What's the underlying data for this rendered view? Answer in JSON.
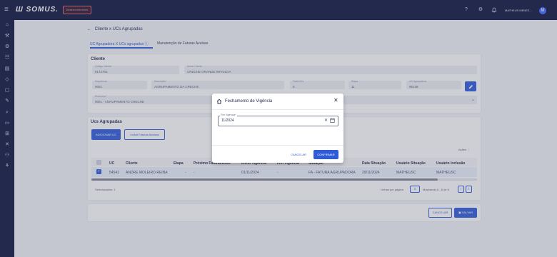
{
  "topbar": {
    "menu_icon": "≡",
    "logo": "Ш SOMUS.",
    "env_badge": "Desenvolvimento",
    "help_icon": "?",
    "settings_icon": "⚙",
    "bell_icon": "🔔",
    "user_name": "MATHEUS MENEZ...",
    "avatar": "M"
  },
  "sidebar": {
    "icons": [
      "⌂",
      "⚒",
      "⚙",
      "☷",
      "▤",
      "◇",
      "▢",
      "✎",
      "⌕",
      "▭",
      "⊞",
      "✕",
      "⚇",
      "⚘"
    ]
  },
  "page": {
    "back_arrow": "←",
    "title": "Cliente x UCs Agrupadas",
    "tabs": [
      "UC Agrupadora X UCs agrupadas ⓘ",
      "Manutenção de Faturas Avulsas"
    ]
  },
  "client": {
    "title": "Cliente",
    "codigo_label": "Código Cliente",
    "codigo_value": "6172703",
    "nome_label": "Nome Cliente",
    "nome_value": "CRECHE GRANDE INFANCIA",
    "sequencia_label": "Sequência",
    "sequencia_value": "0001",
    "descricao_label": "Descrição*",
    "descricao_value": "AGRUPAMENTO DA CRECHE",
    "total_label": "Total UCs",
    "total_value": "0",
    "etapa_label": "Etapa",
    "etapa_value": "11",
    "uc_label": "UC Agrupadora",
    "uc_value": "95138",
    "endereco_label": "Endereço*",
    "endereco_value": "0001 - AGRUPAMENTO CRECHE"
  },
  "ucs": {
    "title": "Ucs Agrupadas",
    "add_button": "ADICIONAR UC",
    "include_button": "Incluir Faturas Avulsas",
    "acoes_label": "Ações",
    "columns": [
      "UC",
      "Cliente",
      "Etapa",
      "Próximo Faturamento",
      "Início Vigência",
      "Fim Vigência",
      "Situação",
      "Data Situação",
      "Usuário Situação",
      "Usuário Inclusão"
    ],
    "row": [
      "54541",
      "ANDRE MOLEIRO REINA",
      "-",
      "-",
      "01/11/2024",
      "-",
      "FA - FATURA AGRUPADORA",
      "29/11/2024",
      "MATHEUSC",
      "MATHEUSC"
    ],
    "selected_count": "Selecionados: 1",
    "rows_per_page_label": "Linhas por página",
    "rows_per_page": "5",
    "range": "Mostrando 6 - 6 de 6"
  },
  "footer": {
    "cancel": "CANCELAR",
    "save": "SALVAR"
  },
  "modal": {
    "title": "Fechamento de Vigência",
    "title_icon": "home-icon",
    "close": "✕",
    "field_label": "Fim Vigência*",
    "field_value": "11/2024",
    "cancel": "CANCELAR",
    "confirm": "CONFIRMAR"
  }
}
